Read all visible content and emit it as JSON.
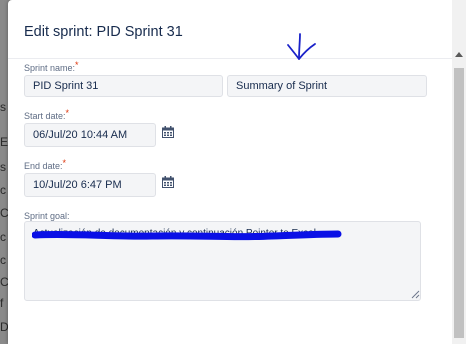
{
  "backdrop_glyphs": [
    "s",
    "E",
    "s",
    "c",
    "C",
    "c",
    "c",
    "C",
    "f",
    "D"
  ],
  "dialog": {
    "title": "Edit sprint: PID Sprint 31"
  },
  "form": {
    "sprint_name": {
      "label": "Sprint name:",
      "required_mark": "*",
      "value": "PID Sprint 31"
    },
    "summary": {
      "value": "Summary of Sprint"
    },
    "start_date": {
      "label": "Start date:",
      "required_mark": "*",
      "value": "06/Jul/20 10:44 AM"
    },
    "end_date": {
      "label": "End date:",
      "required_mark": "*",
      "value": "10/Jul/20 6:47 PM"
    },
    "sprint_goal": {
      "label": "Sprint goal:",
      "value": "Actualización de documentación y continuación Pointer to Excel"
    }
  },
  "colors": {
    "redaction": "#0a10e6",
    "annotation_arrow": "#1a22c9",
    "required": "#de350b"
  },
  "icons": {
    "calendar": "calendar-icon",
    "annotation": "down-arrow-annotation-icon",
    "resize": "resize-handle-icon"
  }
}
